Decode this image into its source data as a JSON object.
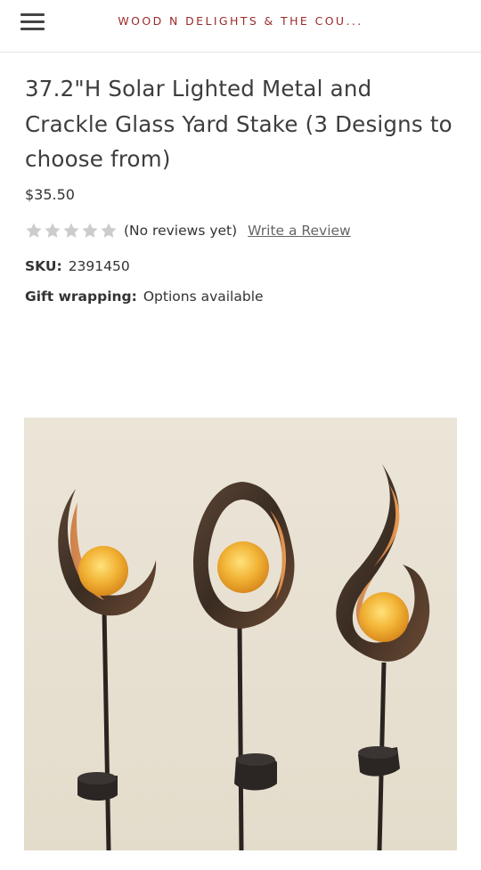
{
  "header": {
    "store_name": "WOOD N DELIGHTS & THE COU...",
    "menu_icon": "hamburger-menu-icon"
  },
  "product": {
    "title": "37.2\"H Solar Lighted Metal and Crackle Glass Yard Stake (3 Designs to choose from)",
    "price": "$35.50",
    "rating": {
      "stars_filled": 0,
      "stars_total": 5,
      "reviews_text": "(No reviews yet)",
      "write_review_label": "Write a Review"
    },
    "sku": {
      "label": "SKU:",
      "value": "2391450"
    },
    "gift_wrapping": {
      "label": "Gift wrapping:",
      "value": "Options available"
    }
  },
  "colors": {
    "store_name": "#9b2a2a",
    "star_empty": "#cccccc",
    "text": "#333333",
    "image_background": "#e9e2d3",
    "glow": "#f2b437"
  }
}
